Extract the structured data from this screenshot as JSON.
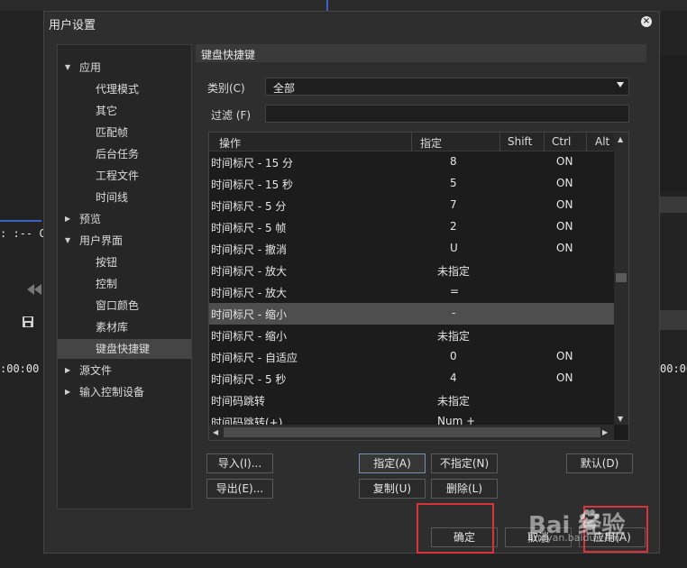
{
  "background": {
    "timecode": ": :--   C",
    "time_left": ":00:00",
    "time_right": "00:00"
  },
  "dialog": {
    "title": "用户设置",
    "close_label": "×"
  },
  "tree": {
    "items": [
      {
        "label": "应用",
        "level": 0,
        "expanded": true
      },
      {
        "label": "代理模式",
        "level": 1
      },
      {
        "label": "其它",
        "level": 1
      },
      {
        "label": "匹配帧",
        "level": 1
      },
      {
        "label": "后台任务",
        "level": 1
      },
      {
        "label": "工程文件",
        "level": 1
      },
      {
        "label": "时间线",
        "level": 1
      },
      {
        "label": "预览",
        "level": 0,
        "expanded": false
      },
      {
        "label": "用户界面",
        "level": 0,
        "expanded": true
      },
      {
        "label": "按钮",
        "level": 1
      },
      {
        "label": "控制",
        "level": 1
      },
      {
        "label": "窗口颜色",
        "level": 1
      },
      {
        "label": "素材库",
        "level": 1
      },
      {
        "label": "键盘快捷键",
        "level": 1,
        "selected": true
      },
      {
        "label": "源文件",
        "level": 0,
        "expanded": false
      },
      {
        "label": "输入控制设备",
        "level": 0,
        "expanded": false
      }
    ]
  },
  "panel": {
    "section_title": "键盘快捷键",
    "category_label": "类别(C)",
    "category_value": "全部",
    "filter_label": "过滤 (F)",
    "filter_value": ""
  },
  "grid": {
    "columns": [
      "操作",
      "指定",
      "Shift",
      "Ctrl",
      "Alt"
    ],
    "rows": [
      {
        "action": "时间标尺 - 15 分",
        "key": "8",
        "shift": "",
        "ctrl": "ON",
        "alt": ""
      },
      {
        "action": "时间标尺 - 15 秒",
        "key": "5",
        "shift": "",
        "ctrl": "ON",
        "alt": ""
      },
      {
        "action": "时间标尺 - 5 分",
        "key": "7",
        "shift": "",
        "ctrl": "ON",
        "alt": ""
      },
      {
        "action": "时间标尺 - 5 帧",
        "key": "2",
        "shift": "",
        "ctrl": "ON",
        "alt": ""
      },
      {
        "action": "时间标尺 - 撤消",
        "key": "U",
        "shift": "",
        "ctrl": "ON",
        "alt": ""
      },
      {
        "action": "时间标尺 - 放大",
        "key": "未指定",
        "shift": "",
        "ctrl": "",
        "alt": ""
      },
      {
        "action": "时间标尺 - 放大",
        "key": "=",
        "shift": "",
        "ctrl": "",
        "alt": ""
      },
      {
        "action": "时间标尺 - 缩小",
        "key": "-",
        "shift": "",
        "ctrl": "",
        "alt": "",
        "selected": true
      },
      {
        "action": "时间标尺 - 缩小",
        "key": "未指定",
        "shift": "",
        "ctrl": "",
        "alt": ""
      },
      {
        "action": "时间标尺 - 自适应",
        "key": "0",
        "shift": "",
        "ctrl": "ON",
        "alt": ""
      },
      {
        "action": "时间标尺 - 5 秒",
        "key": "4",
        "shift": "",
        "ctrl": "ON",
        "alt": ""
      },
      {
        "action": "时间码跳转",
        "key": "未指定",
        "shift": "",
        "ctrl": "",
        "alt": ""
      },
      {
        "action": "时间码跳转(+)",
        "key": "Num +",
        "shift": "",
        "ctrl": "",
        "alt": ""
      }
    ]
  },
  "buttons": {
    "import": "导入(I)...",
    "export": "导出(E)...",
    "assign": "指定(A)",
    "unassign": "不指定(N)",
    "copy": "复制(U)",
    "delete": "删除(L)",
    "default": "默认(D)",
    "ok": "确定",
    "cancel": "取消",
    "apply": "应用(A)"
  },
  "watermark": {
    "text": "Bai 经验",
    "sub": "jingyan.baidu.com"
  },
  "colors": {
    "highlight": "#d8343a",
    "selection": "#4e4e4e"
  }
}
